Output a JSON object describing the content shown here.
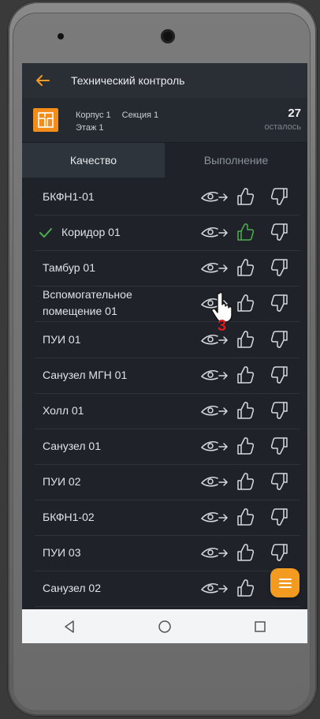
{
  "header": {
    "title": "Технический контроль"
  },
  "object": {
    "building": "Корпус 1",
    "section": "Секция 1",
    "floor": "Этаж 1",
    "remaining_count": "27",
    "remaining_label": "осталось"
  },
  "tabs": [
    {
      "label": "Качество",
      "active": true
    },
    {
      "label": "Выполнение",
      "active": false
    }
  ],
  "rows": [
    {
      "label": "БКФН1-01",
      "checked": false
    },
    {
      "label": "Коридор 01",
      "checked": true
    },
    {
      "label": "Тамбур 01",
      "checked": false
    },
    {
      "label": "Вспомогательное помещение 01",
      "checked": false
    },
    {
      "label": "ПУИ 01",
      "checked": false
    },
    {
      "label": "Санузел МГН 01",
      "checked": false
    },
    {
      "label": "Холл 01",
      "checked": false
    },
    {
      "label": "Санузел 01",
      "checked": false
    },
    {
      "label": "ПУИ 02",
      "checked": false
    },
    {
      "label": "БКФН1-02",
      "checked": false
    },
    {
      "label": "ПУИ 03",
      "checked": false
    },
    {
      "label": "Санузел 02",
      "checked": false
    }
  ],
  "cursor_step": "3",
  "colors": {
    "accent": "#f39a21",
    "approve": "#4caf50",
    "background": "#1f2329"
  },
  "icons": [
    "back-arrow-icon",
    "building-icon",
    "eye-icon",
    "thumbs-up-icon",
    "thumbs-down-icon",
    "menu-icon",
    "nav-back-icon",
    "nav-home-icon",
    "nav-recents-icon",
    "hand-cursor-icon"
  ]
}
